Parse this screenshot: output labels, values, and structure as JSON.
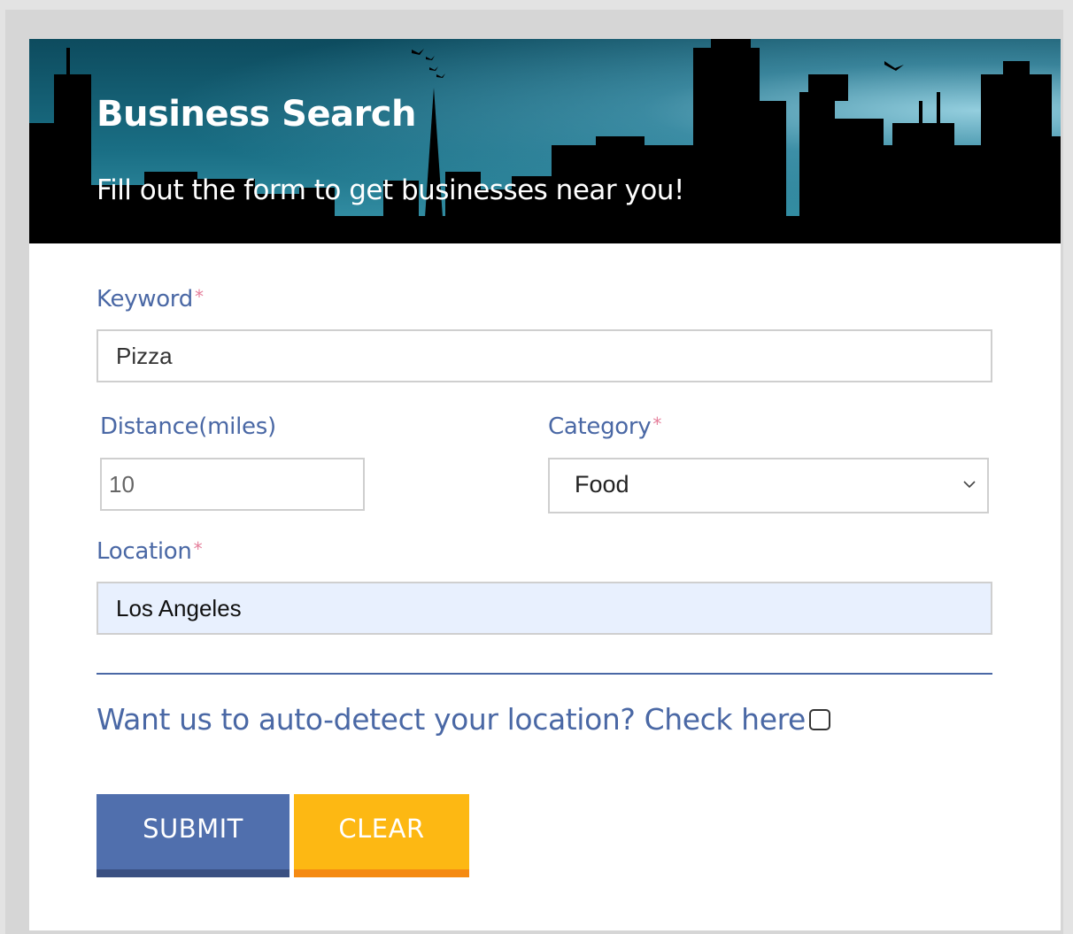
{
  "header": {
    "title": "Business Search",
    "subtitle": "Fill out the form to get businesses near you!"
  },
  "form": {
    "keyword": {
      "label": "Keyword",
      "required_mark": "*",
      "value": "Pizza"
    },
    "distance": {
      "label": "Distance(miles)",
      "value": "10"
    },
    "category": {
      "label": "Category",
      "required_mark": "*",
      "selected": "Food",
      "icon": "chevron-down-icon"
    },
    "location": {
      "label": "Location",
      "required_mark": "*",
      "value": "Los Angeles"
    },
    "autodetect": {
      "text": "Want us to auto-detect your location? Check here",
      "checked": false
    }
  },
  "buttons": {
    "submit": "SUBMIT",
    "clear": "CLEAR"
  },
  "colors": {
    "label": "#4a68a5",
    "required": "#e57e9a",
    "submit": "#506fad",
    "submit_border": "#3a5082",
    "clear": "#fdb813",
    "clear_border": "#f58a12",
    "autofill_bg": "#e8f0fe"
  }
}
